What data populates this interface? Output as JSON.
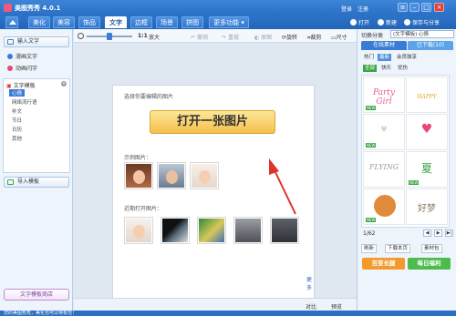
{
  "window": {
    "title": "美图秀秀 4.0.1",
    "login": "登录",
    "register": "注册",
    "nav_prev": "◀"
  },
  "tabs": [
    "美化",
    "美容",
    "饰品",
    "文字",
    "边框",
    "场景",
    "拼图",
    "更多功能 ▾"
  ],
  "topbar_actions": {
    "open": "打开",
    "new": "新建",
    "save": "保存与分享"
  },
  "left_panel": {
    "input_text": "输入文字",
    "art_text": "漫画文字",
    "dynamic_text": "动画闪字",
    "template_header": "文字模板",
    "categories": [
      "心情",
      "网络流行语",
      "补文",
      "节日",
      "日历",
      "其他"
    ],
    "import_template": "导入模板",
    "template_shop": "文字模板商店"
  },
  "toolbar": {
    "ratio": "1:1",
    "enlarge": "放大",
    "undo": "撤销",
    "redo": "重做",
    "original": "原图",
    "rotate": "旋转",
    "crop": "裁剪",
    "size": "尺寸"
  },
  "card": {
    "prompt": "选择你要编辑的图片",
    "open_button": "打开一张图片",
    "samples_label": "示例图片：",
    "recent_label": "近期打开图片：",
    "more": "更多"
  },
  "bottom_tools": {
    "compare": "对比",
    "preview": "预览",
    "zoom": "100%"
  },
  "status": {
    "left": "您的美图秀秀，美化也可以特有范！",
    "right": "拍照入门"
  },
  "right_panel": {
    "category_label": "切换分类",
    "category_value": "(文字模板) 心情",
    "tab_online": "在线素材",
    "tab_downloaded": "已下载(10)",
    "subtabs": [
      "热门",
      "最新",
      "会员独享"
    ],
    "chips": [
      "全部",
      "快乐",
      "忧伤"
    ],
    "grid_texts": [
      "Party Girl",
      "HAPPY",
      "♥",
      "♥",
      "FLYING",
      "夏",
      "",
      "好梦"
    ],
    "new_badge": "NEW",
    "pager": "1/62",
    "actions": [
      "刷新",
      "下载本页",
      "素材包"
    ],
    "banners": [
      "百变长腿",
      "每日福利"
    ]
  },
  "colors": {
    "brand_blue": "#2a6fc4",
    "button_yellow": "#f6c04a",
    "arrow_red": "#e0322d",
    "new_green": "#3aa645",
    "banner_orange": "#f39a2c",
    "banner_green": "#4cbc4c"
  },
  "icons": {
    "home": "home-icon",
    "open": "folder-icon",
    "new": "plus-icon",
    "save": "share-icon",
    "search": "zoom-icon"
  }
}
